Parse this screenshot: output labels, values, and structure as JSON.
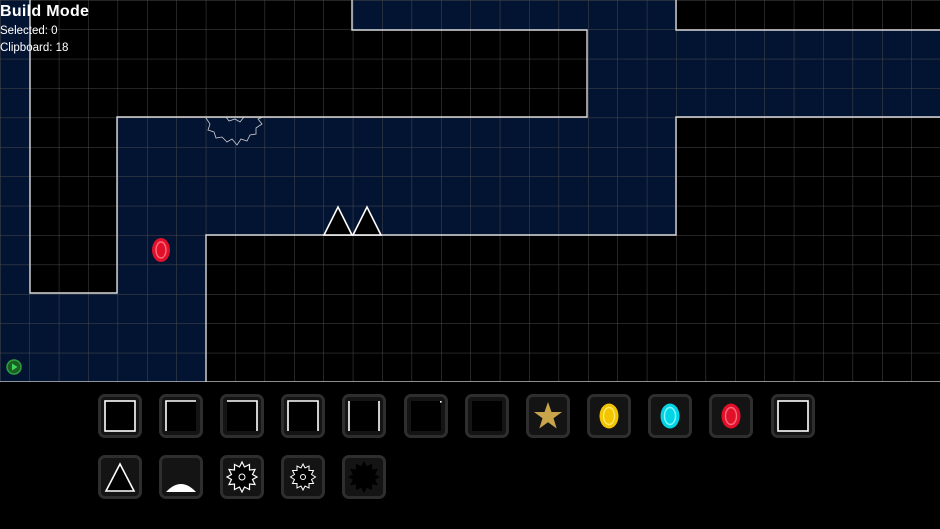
{
  "hud": {
    "title": "Build Mode",
    "selected_label": "Selected: 0",
    "clipboard_label": "Clipboard: 18"
  },
  "colors": {
    "background": "#000000",
    "fill_region": "#031433",
    "grid_line": "#4a4a4a",
    "wall_edge": "#d9d9d9",
    "star": "#c8a44a",
    "coin_yellow": "#f2c500",
    "coin_cyan": "#00d5e6",
    "coin_red": "#e0102a",
    "play_green": "#2e9e3c"
  },
  "level_objects": [
    "red-coin",
    "spike-pair",
    "sawblade-outline",
    "play-button"
  ],
  "toolbar": {
    "row1": [
      {
        "name": "tool-block-full",
        "icon": "block-full-icon"
      },
      {
        "name": "tool-block-top-left",
        "icon": "block-edge-top-left-icon"
      },
      {
        "name": "tool-block-top-right",
        "icon": "block-edge-top-right-icon"
      },
      {
        "name": "tool-block-top-sides",
        "icon": "block-edge-top-sides-icon"
      },
      {
        "name": "tool-block-sides",
        "icon": "block-edge-sides-icon"
      },
      {
        "name": "tool-block-corner-dot",
        "icon": "block-corner-dot-icon"
      },
      {
        "name": "tool-block-empty",
        "icon": "block-empty-icon"
      },
      {
        "name": "tool-star",
        "icon": "star-icon"
      },
      {
        "name": "tool-coin-yellow",
        "icon": "yellow-coin-icon"
      },
      {
        "name": "tool-coin-cyan",
        "icon": "cyan-coin-icon"
      },
      {
        "name": "tool-coin-red",
        "icon": "red-coin-icon"
      },
      {
        "name": "tool-block-outline",
        "icon": "block-outline-icon"
      }
    ],
    "row2": [
      {
        "name": "tool-spike",
        "icon": "spike-icon"
      },
      {
        "name": "tool-half-dome",
        "icon": "half-dome-icon"
      },
      {
        "name": "tool-saw-large",
        "icon": "sawblade-large-icon"
      },
      {
        "name": "tool-saw-small",
        "icon": "sawblade-small-icon"
      },
      {
        "name": "tool-saw-solid",
        "icon": "sawblade-solid-icon"
      }
    ]
  }
}
